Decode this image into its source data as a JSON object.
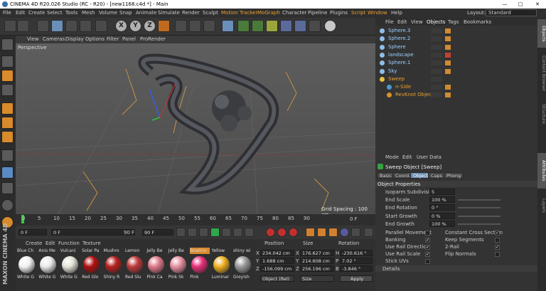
{
  "titlebar": {
    "title": "CINEMA 4D R20.026 Studio (RC - R20) - [new1168.c4d *] - Main",
    "min": "—",
    "max": "□",
    "close": "✕"
  },
  "menubar": {
    "items": [
      "File",
      "Edit",
      "Create",
      "Select",
      "Tools",
      "Mesh",
      "Volume",
      "Snap",
      "Animate",
      "Simulate",
      "Render",
      "Sculpt",
      "Motion Tracker",
      "MoGraph",
      "Character",
      "Pipeline",
      "Plugins",
      "Script",
      "Window",
      "Help"
    ],
    "layout_label": "Layout:",
    "layout_value": "Standard"
  },
  "viewport": {
    "menu": [
      "View",
      "Cameras",
      "Display",
      "Options",
      "Filter",
      "Panel",
      "ProRender"
    ],
    "label": "Perspective",
    "grid_spacing": "Grid Spacing : 100 cm"
  },
  "timeline": {
    "ticks": [
      "0",
      "5",
      "10",
      "15",
      "20",
      "25",
      "30",
      "35",
      "40",
      "45",
      "50",
      "55",
      "60",
      "65",
      "70",
      "75",
      "80",
      "85",
      "90"
    ],
    "end_frame": "0 F"
  },
  "transport": {
    "start": "0 F",
    "current": "0 F",
    "end_a": "90 F",
    "end_b": "90 F"
  },
  "materials": {
    "menu": [
      "Create",
      "Edit",
      "Function",
      "Texture"
    ],
    "row1": [
      "Blue Ch",
      "Anis Me",
      "Vulcani",
      "Solar Pa",
      "Mushro",
      "Lemon",
      "Jelly Be",
      "Jelly Be",
      "Bowlinv",
      "Yellow",
      "shiny wi"
    ],
    "row2": [
      "White G",
      "White G",
      "White G",
      "Red Glo",
      "Shiny R",
      "Red Slu",
      "Pink Ca",
      "Pink Sk",
      "Pink",
      "Luminar",
      "Greyish"
    ],
    "colors": [
      "#f2f2f2",
      "#eaeaea",
      "#e4e4d8",
      "#b01010",
      "#b82020",
      "#c03a3a",
      "#e07a8a",
      "#e890a0",
      "#e8307a",
      "#f0b020",
      "#9a9a9a"
    ]
  },
  "coords": {
    "headers": [
      "Position",
      "Size",
      "Rotation"
    ],
    "labels": [
      "X",
      "Y",
      "Z"
    ],
    "position": [
      "234.042 cm",
      "1.688 cm",
      "-156.099 cm"
    ],
    "size": [
      "176.627 cm",
      "214.608 cm",
      "256.196 cm"
    ],
    "rotation": [
      "-230.616 °",
      "7.02 °",
      "-3.846 °"
    ],
    "rot_labels": [
      "H",
      "P",
      "B"
    ],
    "mode": "Object (Rel)",
    "size_mode": "Size",
    "apply": "Apply"
  },
  "objects": {
    "menu": [
      "File",
      "Edit",
      "View",
      "Objects",
      "Tags",
      "Bookmarks"
    ],
    "items": [
      "Sphere.3",
      "Sphere.2",
      "Sphere",
      "landscape",
      "Sphere.1",
      "Sky",
      "Sweep",
      "n-Side",
      "RevKnot Object"
    ]
  },
  "attributes": {
    "menu": [
      "Mode",
      "Edit",
      "User Data"
    ],
    "object_title": "Sweep Object [Sweep]",
    "tabs": [
      "Basic",
      "Coord.",
      "Object",
      "Caps",
      "Phong"
    ],
    "section": "Object Properties",
    "props": [
      {
        "label": "Isoparm Subdivision",
        "value": "5"
      },
      {
        "label": "End Scale",
        "value": "100 %"
      },
      {
        "label": "End Rotation",
        "value": "0 °"
      },
      {
        "label": "Start Growth",
        "value": "0 %"
      },
      {
        "label": "End Growth",
        "value": "100 %"
      }
    ],
    "checks_left": [
      "Parallel Movement",
      "Banking",
      "Use Rail Direction",
      "Use Rail Scale",
      "Stick UVs"
    ],
    "checks_right": [
      "Constant Cross Section",
      "Keep Segments",
      "2-Rail",
      "Flip Normals"
    ],
    "details": "Details"
  },
  "right_strip": [
    "Objects",
    "Content Browser",
    "Structure",
    "Attributes",
    "Layers"
  ],
  "brand": "MAXON CINEMA 4D"
}
